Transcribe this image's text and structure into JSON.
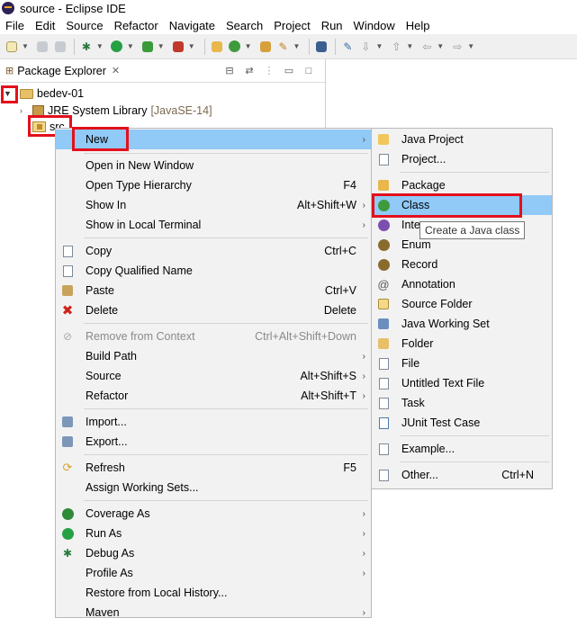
{
  "window": {
    "title": "source - Eclipse IDE"
  },
  "menubar": [
    "File",
    "Edit",
    "Source",
    "Refactor",
    "Navigate",
    "Search",
    "Project",
    "Run",
    "Window",
    "Help"
  ],
  "panel": {
    "tab_label": "Package Explorer"
  },
  "tree": {
    "project": "bedev-01",
    "library": "JRE System Library",
    "library_suffix": "[JavaSE-14]",
    "src": "src"
  },
  "context_menu": {
    "new": "New",
    "open_new_window": "Open in New Window",
    "open_type_hierarchy": "Open Type Hierarchy",
    "open_type_hierarchy_sc": "F4",
    "show_in": "Show In",
    "show_in_sc": "Alt+Shift+W",
    "show_in_terminal": "Show in Local Terminal",
    "copy": "Copy",
    "copy_sc": "Ctrl+C",
    "copy_qualified": "Copy Qualified Name",
    "paste": "Paste",
    "paste_sc": "Ctrl+V",
    "delete": "Delete",
    "delete_sc": "Delete",
    "remove_context": "Remove from Context",
    "remove_context_sc": "Ctrl+Alt+Shift+Down",
    "build_path": "Build Path",
    "source": "Source",
    "source_sc": "Alt+Shift+S",
    "refactor": "Refactor",
    "refactor_sc": "Alt+Shift+T",
    "import": "Import...",
    "export": "Export...",
    "refresh": "Refresh",
    "refresh_sc": "F5",
    "assign_working_sets": "Assign Working Sets...",
    "coverage_as": "Coverage As",
    "run_as": "Run As",
    "debug_as": "Debug As",
    "profile_as": "Profile As",
    "restore_history": "Restore from Local History...",
    "maven": "Maven"
  },
  "submenu": {
    "java_project": "Java Project",
    "project": "Project...",
    "package": "Package",
    "class": "Class",
    "interface": "Inte",
    "enum": "Enum",
    "record": "Record",
    "annotation": "Annotation",
    "source_folder": "Source Folder",
    "java_working_set": "Java Working Set",
    "folder": "Folder",
    "file": "File",
    "untitled_text_file": "Untitled Text File",
    "task": "Task",
    "junit_test_case": "JUnit Test Case",
    "example": "Example...",
    "other": "Other...",
    "other_sc": "Ctrl+N"
  },
  "tooltip": {
    "text": "Create a Java class"
  },
  "colors": {
    "highlight": "#91c9f7",
    "annotation_box": "#e3101b",
    "menu_bg": "#f2f2f2"
  }
}
